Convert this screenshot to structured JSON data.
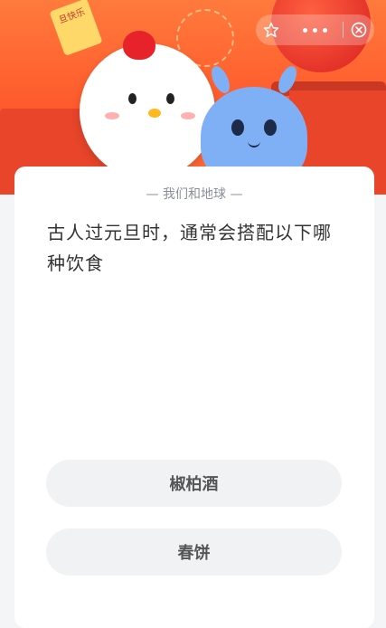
{
  "banner": {
    "tag_text": "旦快乐"
  },
  "capsule": {
    "favorite_icon": "star-icon",
    "more_icon": "more-dots-icon",
    "close_icon": "close-circle-icon"
  },
  "quiz": {
    "category": "— 我们和地球 —",
    "question": "古人过元旦时，通常会搭配以下哪种饮食",
    "options": [
      {
        "label": "椒柏酒"
      },
      {
        "label": "春饼"
      }
    ]
  },
  "colors": {
    "banner": "#ff5a2c",
    "card": "#ffffff",
    "option_bg": "#f1f2f4",
    "question_text": "#333333"
  }
}
